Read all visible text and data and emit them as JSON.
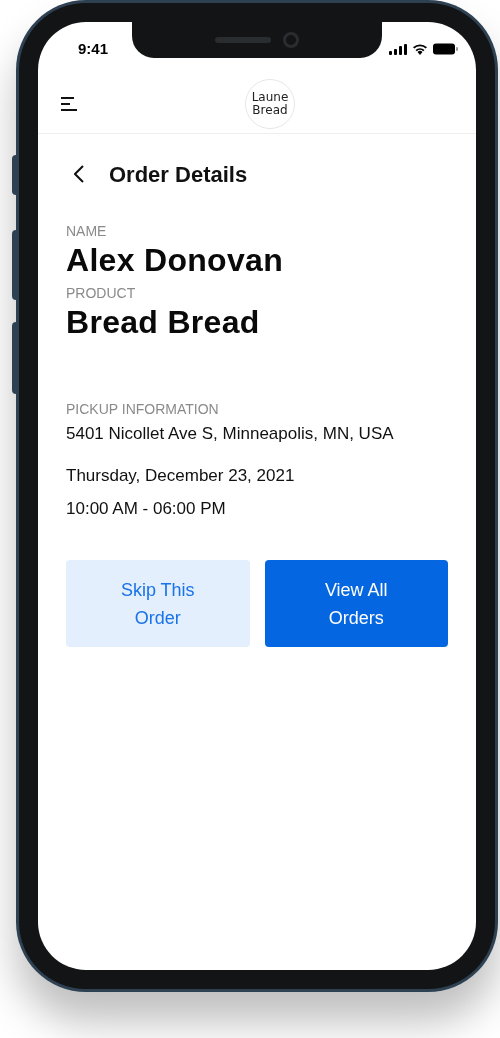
{
  "status_bar": {
    "time": "9:41"
  },
  "header": {
    "logo_lines": [
      "Laune",
      "Bread"
    ]
  },
  "page": {
    "title": "Order Details"
  },
  "fields": [
    {
      "label": "NAME",
      "value": "Alex Donovan",
      "kind": "large"
    },
    {
      "label": "PRODUCT",
      "value": "Bread Bread",
      "kind": "large"
    }
  ],
  "pickup": {
    "label": "PICKUP INFORMATION",
    "lines": [
      "5401 Nicollet Ave S, Minneapolis, MN, USA",
      "Thursday, December 23, 2021",
      "10:00 AM - 06:00 PM"
    ]
  },
  "buttons": [
    {
      "label": "Skip This Order",
      "kind": "secondary"
    },
    {
      "label": "View All Orders",
      "kind": "primary"
    }
  ]
}
